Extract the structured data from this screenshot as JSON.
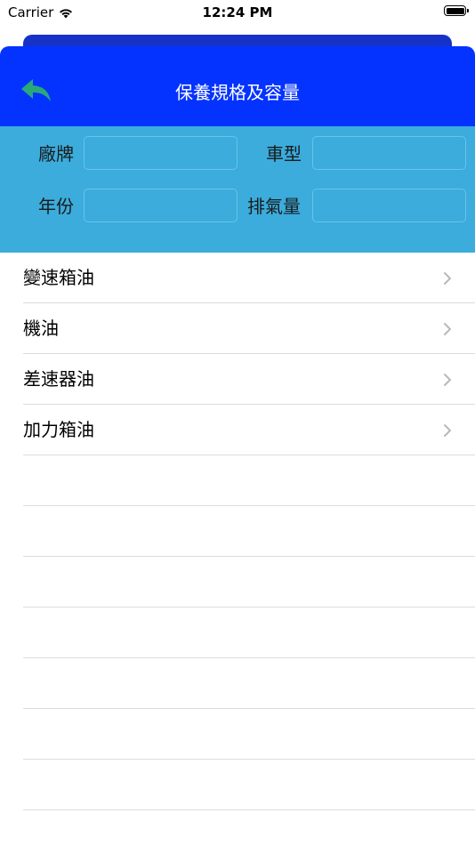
{
  "status_bar": {
    "carrier": "Carrier",
    "time": "12:24 PM"
  },
  "nav": {
    "title": "保養規格及容量",
    "back_icon": "reply-arrow-icon",
    "background": "#0433ff",
    "back_icon_color": "#2aa87a"
  },
  "filters": {
    "background": "#3bacdc",
    "brand_label": "廠牌",
    "brand_value": "",
    "model_label": "車型",
    "model_value": "",
    "year_label": "年份",
    "year_value": "",
    "displacement_label": "排氣量",
    "displacement_value": ""
  },
  "list": {
    "items": [
      {
        "label": "變速箱油"
      },
      {
        "label": "機油"
      },
      {
        "label": "差速器油"
      },
      {
        "label": "加力箱油"
      }
    ],
    "chevron_icon": "chevron-right-icon"
  }
}
